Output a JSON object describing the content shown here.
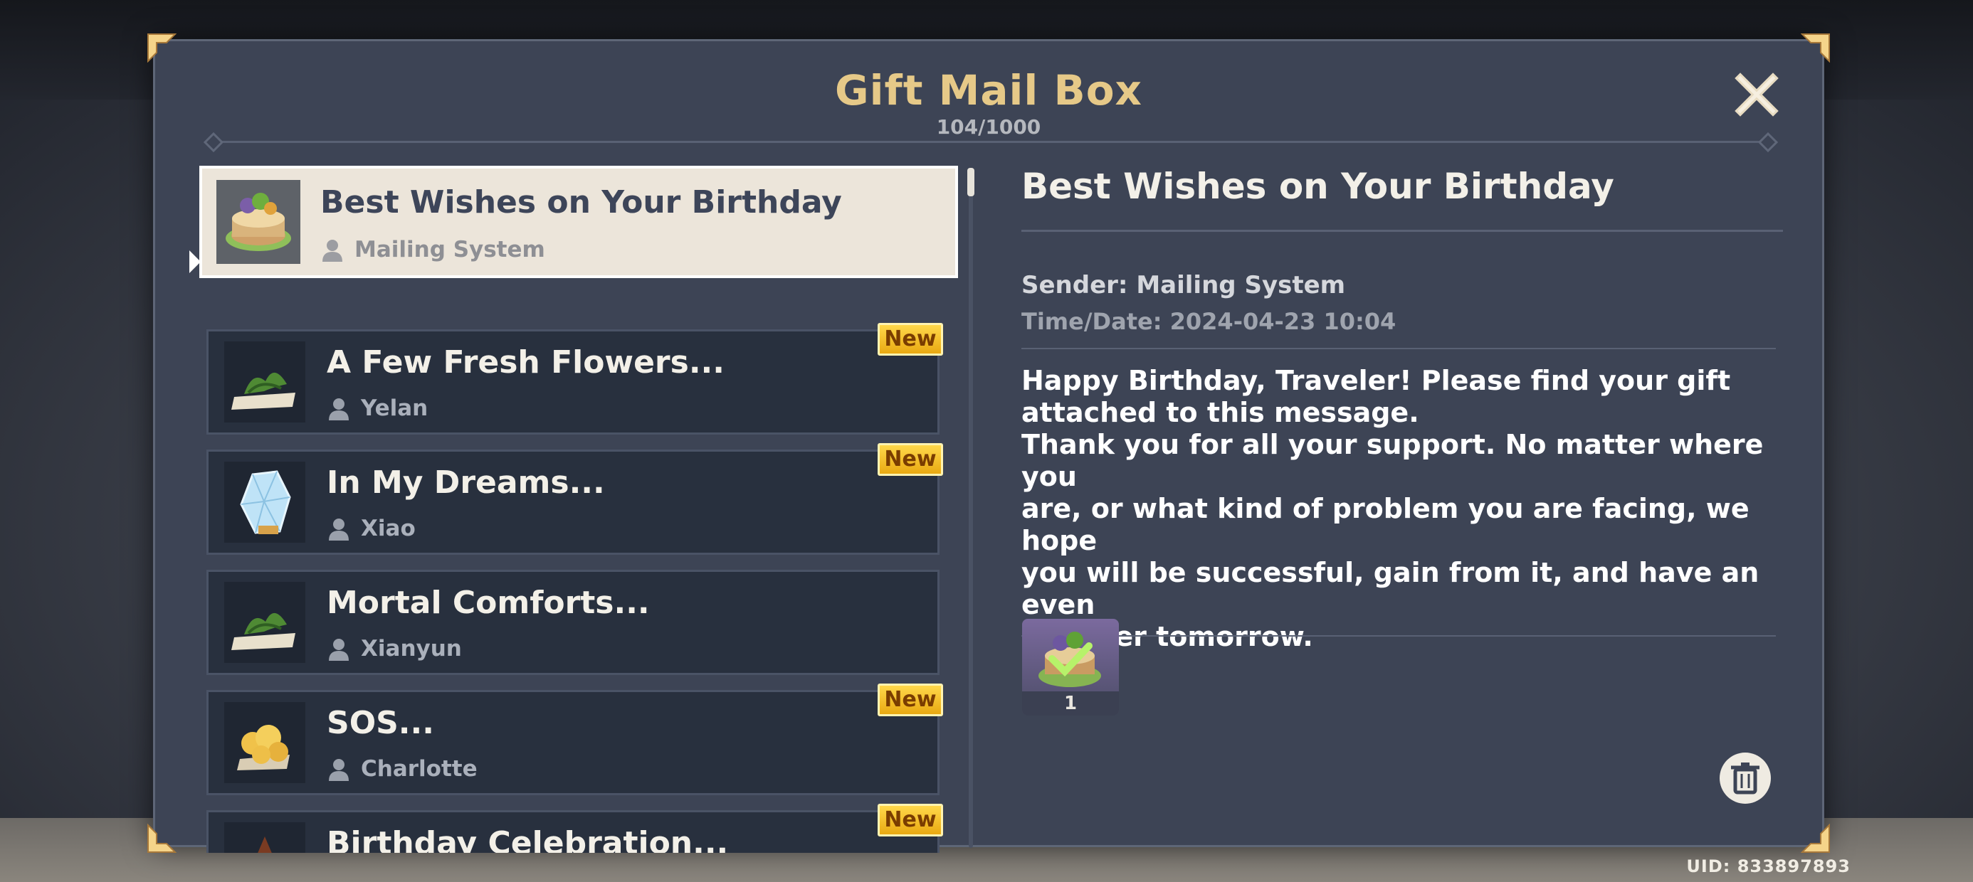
{
  "window": {
    "title": "Gift Mail Box",
    "count": "104/1000"
  },
  "mails": [
    {
      "subject": "Best Wishes on Your Birthday",
      "sender": "Mailing System",
      "icon": "birthday-cake-icon",
      "badge": null,
      "selected": true
    },
    {
      "subject": "A Few Fresh Flowers...",
      "sender": "Yelan",
      "icon": "herbs-on-plate-icon",
      "badge": "New"
    },
    {
      "subject": "In My Dreams...",
      "sender": "Xiao",
      "icon": "crystal-icon",
      "badge": "New"
    },
    {
      "subject": "Mortal Comforts...",
      "sender": "Xianyun",
      "icon": "herbs-on-plate-icon",
      "badge": null
    },
    {
      "subject": "SOS...",
      "sender": "Charlotte",
      "icon": "pastry-icon",
      "badge": "New"
    },
    {
      "subject": "Birthday Celebration...",
      "sender": "",
      "icon": "dish-icon",
      "badge": "New"
    }
  ],
  "detail": {
    "subject": "Best Wishes on Your Birthday",
    "sender": "Sender: Mailing System",
    "time": "Time/Date: 2024-04-23 10:04",
    "body": "Happy Birthday, Traveler! Please find your gift\nattached to this message.\nThank you for all your support. No matter where you\nare, or what kind of problem you are facing, we hope\nyou will be successful, gain from it, and have an even\nbrighter tomorrow.",
    "attachment": {
      "quantity": "1",
      "icon": "birthday-cake-claimed-icon"
    }
  },
  "footer": {
    "uid": "UID: 833897893"
  },
  "colors": {
    "title_gold": "#e6c988",
    "panel": "#3d4455",
    "item_bg": "#28303e",
    "selected_bg": "#ece5da",
    "badge": "#f2c12e"
  }
}
